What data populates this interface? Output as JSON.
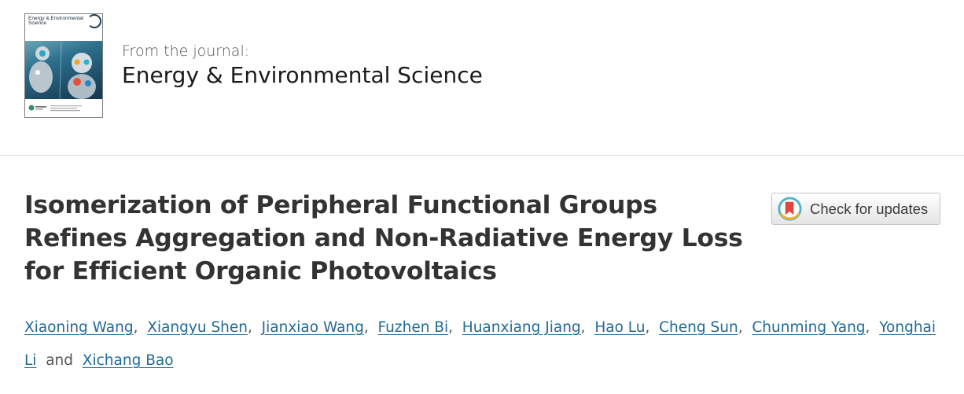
{
  "journal": {
    "cover_title": "Energy & Environmental Science",
    "from_label": "From the journal:",
    "name": "Energy & Environmental Science"
  },
  "article": {
    "title": "Isomerization of Peripheral Functional Groups Refines Aggregation and Non-Radiative Energy Loss for Efficient Organic Photovoltaics"
  },
  "crossmark": {
    "label": "Check for updates",
    "icon": "crossmark-icon",
    "colors": {
      "ring": "#4fb3c9",
      "bookmark": "#e0463d",
      "accent": "#f3b328"
    }
  },
  "authors": {
    "list": [
      "Xiaoning Wang",
      "Xiangyu Shen",
      "Jianxiao Wang",
      "Fuzhen Bi",
      "Huanxiang Jiang",
      "Hao Lu",
      "Cheng Sun",
      "Chunming Yang",
      "Yonghai Li",
      "Xichang Bao"
    ],
    "separator": ",",
    "and_label": "and"
  },
  "colors": {
    "link": "#1f6a99",
    "title": "#333333",
    "divider": "#e2e2e2"
  }
}
